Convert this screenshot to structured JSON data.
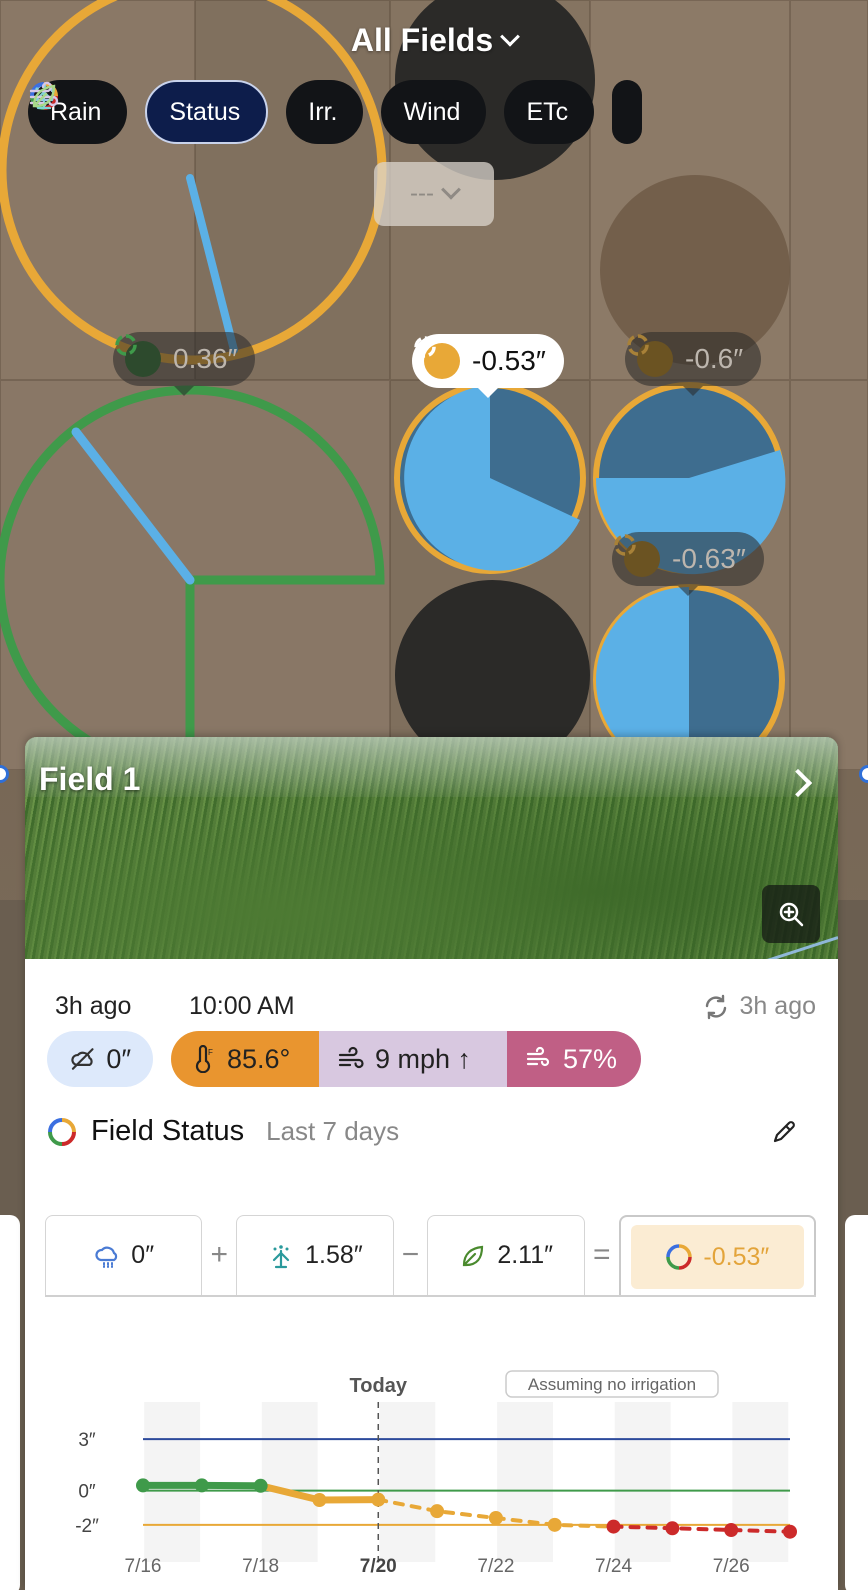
{
  "header": {
    "title": "All Fields"
  },
  "layers": [
    {
      "label": "Rain",
      "icon": "rain-cloud-icon",
      "active": false
    },
    {
      "label": "Status",
      "icon": "status-ring-icon",
      "active": true
    },
    {
      "label": "Irr.",
      "icon": "sprinkler-icon",
      "active": false
    },
    {
      "label": "Wind",
      "icon": "wind-icon",
      "active": false
    },
    {
      "label": "ETc",
      "icon": "leaf-cycle-icon",
      "active": false
    }
  ],
  "selector": {
    "value": "---"
  },
  "map_labels": [
    {
      "value": "0.36″",
      "status": "green"
    },
    {
      "value": "-0.53″",
      "status": "orange",
      "selected": true
    },
    {
      "value": "-0.6″",
      "status": "orange"
    },
    {
      "value": "-0.63″",
      "status": "orange"
    }
  ],
  "card": {
    "field_name": "Field 1",
    "rain_age": "3h ago",
    "time": "10:00 AM",
    "updated": "3h ago",
    "rain_value": "0″",
    "temperature": "85.6°",
    "wind": "9 mph ↑",
    "humidity": "57%",
    "status_title": "Field Status",
    "status_range": "Last 7 days",
    "equation": {
      "rain": "0″",
      "plus": "+",
      "irrigation": "1.58″",
      "minus": "−",
      "etc": "2.11″",
      "equals": "=",
      "result": "-0.53″"
    }
  },
  "colors": {
    "green": "#3f9a4a",
    "orange": "#e8a837",
    "blue_pie": "#5bb0e6",
    "red": "#cc2a2a",
    "navy": "#2c4a9b"
  },
  "chart_data": {
    "type": "line",
    "today_label": "Today",
    "annotation": "Assuming no irrigation",
    "x_ticks": [
      "7/16",
      "7/18",
      "7/20",
      "7/22",
      "7/24",
      "7/26"
    ],
    "x_today": "7/20",
    "y_ticks": [
      "3″",
      "0″",
      "-2″"
    ],
    "reference_lines": [
      {
        "value": 3,
        "color": "#2c4a9b"
      },
      {
        "value": 0,
        "color": "#3f9a4a"
      },
      {
        "value": -2,
        "color": "#e8a837"
      }
    ],
    "ylim": [
      -3,
      4
    ],
    "xlim": [
      16,
      27
    ],
    "series": [
      {
        "x": [
          16,
          17,
          18
        ],
        "y": [
          0.3,
          0.3,
          0.28
        ],
        "color": "#3f9a4a",
        "style": "solid"
      },
      {
        "x": [
          18,
          19,
          20
        ],
        "y": [
          0.28,
          -0.55,
          -0.53
        ],
        "color": "#e8a837",
        "style": "solid"
      },
      {
        "x": [
          20,
          21,
          22,
          23,
          24
        ],
        "y": [
          -0.53,
          -1.2,
          -1.6,
          -2.0,
          -2.1
        ],
        "color": "#e8a837",
        "style": "dashed"
      },
      {
        "x": [
          24,
          25,
          26,
          27
        ],
        "y": [
          -2.1,
          -2.2,
          -2.3,
          -2.4
        ],
        "color": "#cc2a2a",
        "style": "dashed"
      }
    ],
    "points": [
      {
        "x": 16,
        "y": 0.3,
        "color": "#3f9a4a"
      },
      {
        "x": 17,
        "y": 0.3,
        "color": "#3f9a4a"
      },
      {
        "x": 18,
        "y": 0.28,
        "color": "#3f9a4a"
      },
      {
        "x": 19,
        "y": -0.55,
        "color": "#e8a837"
      },
      {
        "x": 20,
        "y": -0.53,
        "color": "#e8a837"
      },
      {
        "x": 21,
        "y": -1.2,
        "color": "#e8a837"
      },
      {
        "x": 22,
        "y": -1.6,
        "color": "#e8a837"
      },
      {
        "x": 23,
        "y": -2.0,
        "color": "#e8a837"
      },
      {
        "x": 24,
        "y": -2.1,
        "color": "#cc2a2a"
      },
      {
        "x": 25,
        "y": -2.2,
        "color": "#cc2a2a"
      },
      {
        "x": 26,
        "y": -2.3,
        "color": "#cc2a2a"
      },
      {
        "x": 27,
        "y": -2.4,
        "color": "#cc2a2a"
      }
    ]
  }
}
